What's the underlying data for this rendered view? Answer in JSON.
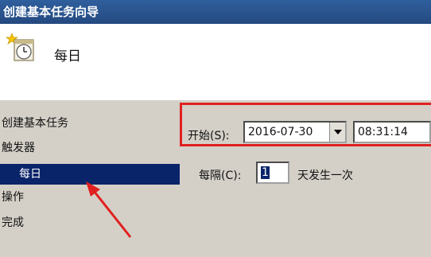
{
  "window": {
    "title": "创建基本任务向导"
  },
  "header": {
    "title": "每日",
    "icon": "calendar-clock-icon"
  },
  "sidebar": {
    "items": [
      {
        "label": "创建基本任务"
      },
      {
        "label": "触发器"
      },
      {
        "label": "每日",
        "selected": true
      },
      {
        "label": "操作"
      },
      {
        "label": "完成"
      }
    ]
  },
  "trigger": {
    "start_label": "开始(S):",
    "start_date": "2016-07-30",
    "start_time": "08:31:14",
    "recur_label": "每隔(C):",
    "recur_value": "1",
    "recur_suffix": "天发生一次"
  },
  "annotations": {
    "highlight_color": "#e02020",
    "arrow_color": "#e02020"
  }
}
